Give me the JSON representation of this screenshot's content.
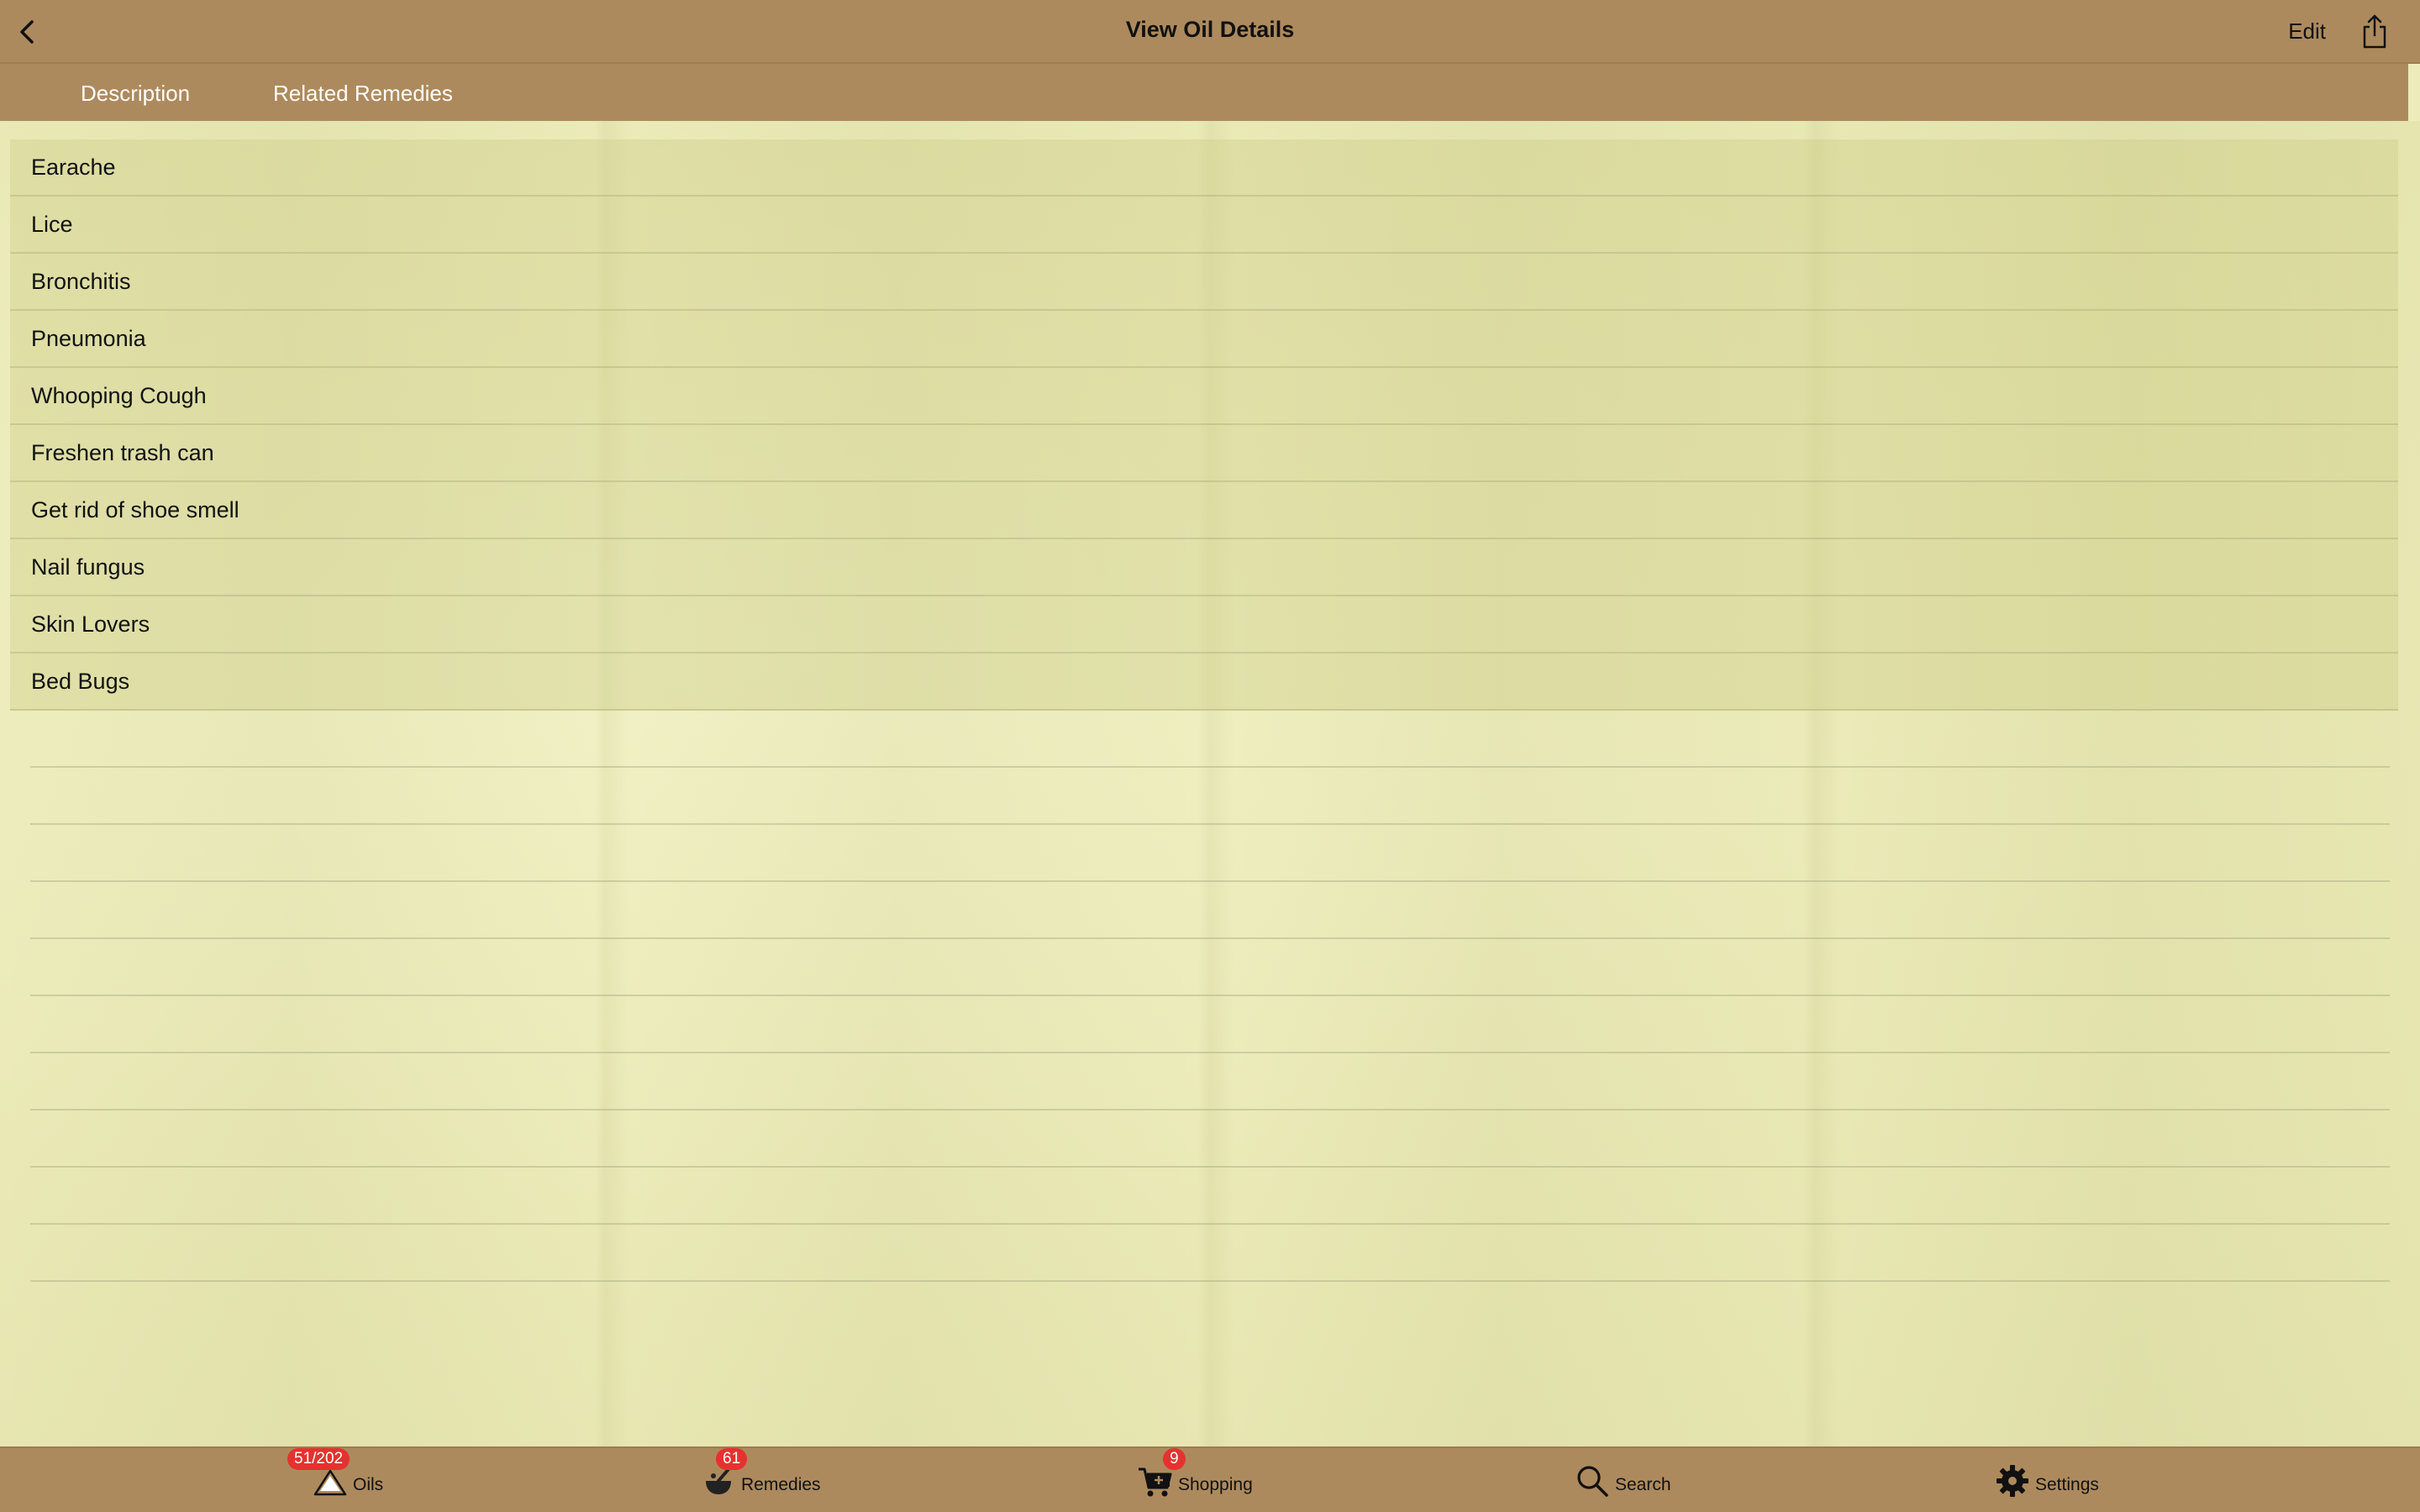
{
  "navbar": {
    "title": "View Oil Details",
    "edit_label": "Edit",
    "back_icon": "chevron-left-icon",
    "share_icon": "share-icon"
  },
  "segments": {
    "description_label": "Description",
    "related_label": "Related Remedies"
  },
  "remedies": [
    "Earache",
    "Lice",
    "Bronchitis",
    "Pneumonia",
    "Whooping Cough",
    "Freshen trash can",
    "Get rid of shoe smell",
    "Nail fungus",
    "Skin Lovers",
    "Bed Bugs"
  ],
  "tabbar": {
    "oils": {
      "label": "Oils",
      "badge": "51/202",
      "icon": "oil-drop-icon"
    },
    "remedies": {
      "label": "Remedies",
      "badge": "61",
      "icon": "mortar-pestle-icon"
    },
    "shopping": {
      "label": "Shopping",
      "badge": "9",
      "icon": "cart-icon"
    },
    "search": {
      "label": "Search",
      "icon": "search-icon"
    },
    "settings": {
      "label": "Settings",
      "icon": "gear-icon"
    }
  },
  "colors": {
    "bar": "#ad8a5d",
    "paper": "#ecebb9",
    "badge": "#e5322f"
  }
}
